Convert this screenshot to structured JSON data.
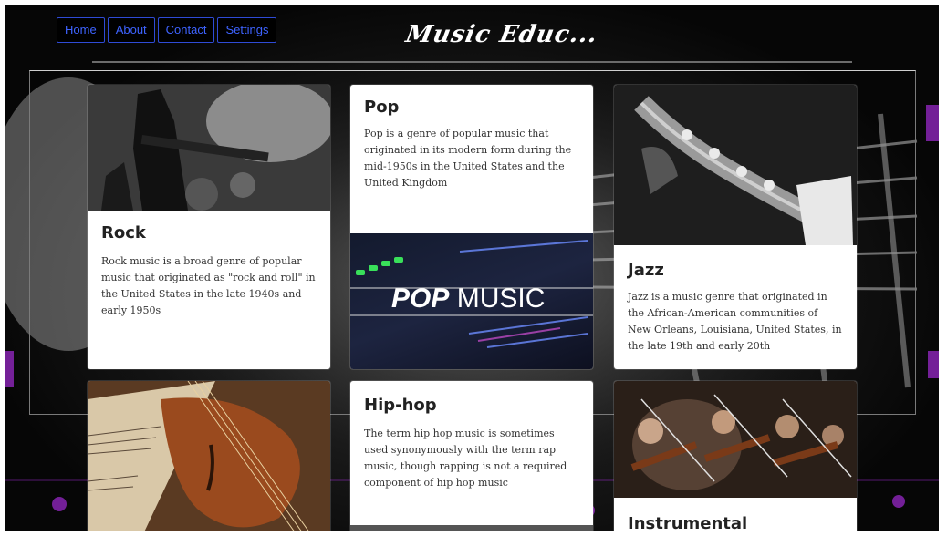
{
  "nav": {
    "items": [
      "Home",
      "About",
      "Contact",
      "Settings"
    ]
  },
  "brand": {
    "title": "Music Educ..."
  },
  "cards": {
    "rock": {
      "title": "Rock",
      "text": "Rock music is a broad genre of popular music that originated as \"rock and roll\" in the United States in the late 1940s and early 1950s",
      "image_icon": "guitarist-on-stage-image"
    },
    "pop": {
      "title": "Pop",
      "text": "Pop is a genre of popular music that originated in its modern form during the mid-1950s in the United States and the United Kingdom",
      "image_label": "POP MUSIC",
      "image_label_bold": "POP",
      "image_label_light": "MUSIC"
    },
    "jazz": {
      "title": "Jazz",
      "text": "Jazz is a music genre that originated in the African-American communities of New Orleans, Louisiana, United States, in the late 19th and early 20th",
      "image_icon": "saxophone-image"
    },
    "violin": {
      "image_icon": "violin-on-sheet-music-image"
    },
    "hiphop": {
      "title": "Hip-hop",
      "text": "The term hip hop music is sometimes used synonymously with the term rap music, though rapping is not a required component of hip hop music"
    },
    "instrumental": {
      "title": "Instrumental",
      "image_icon": "orchestra-violinists-image"
    }
  },
  "colors": {
    "nav_border": "#2f4bd6",
    "nav_text": "#3e63ff",
    "background": "#0a0a0a",
    "card": "#ffffff"
  }
}
